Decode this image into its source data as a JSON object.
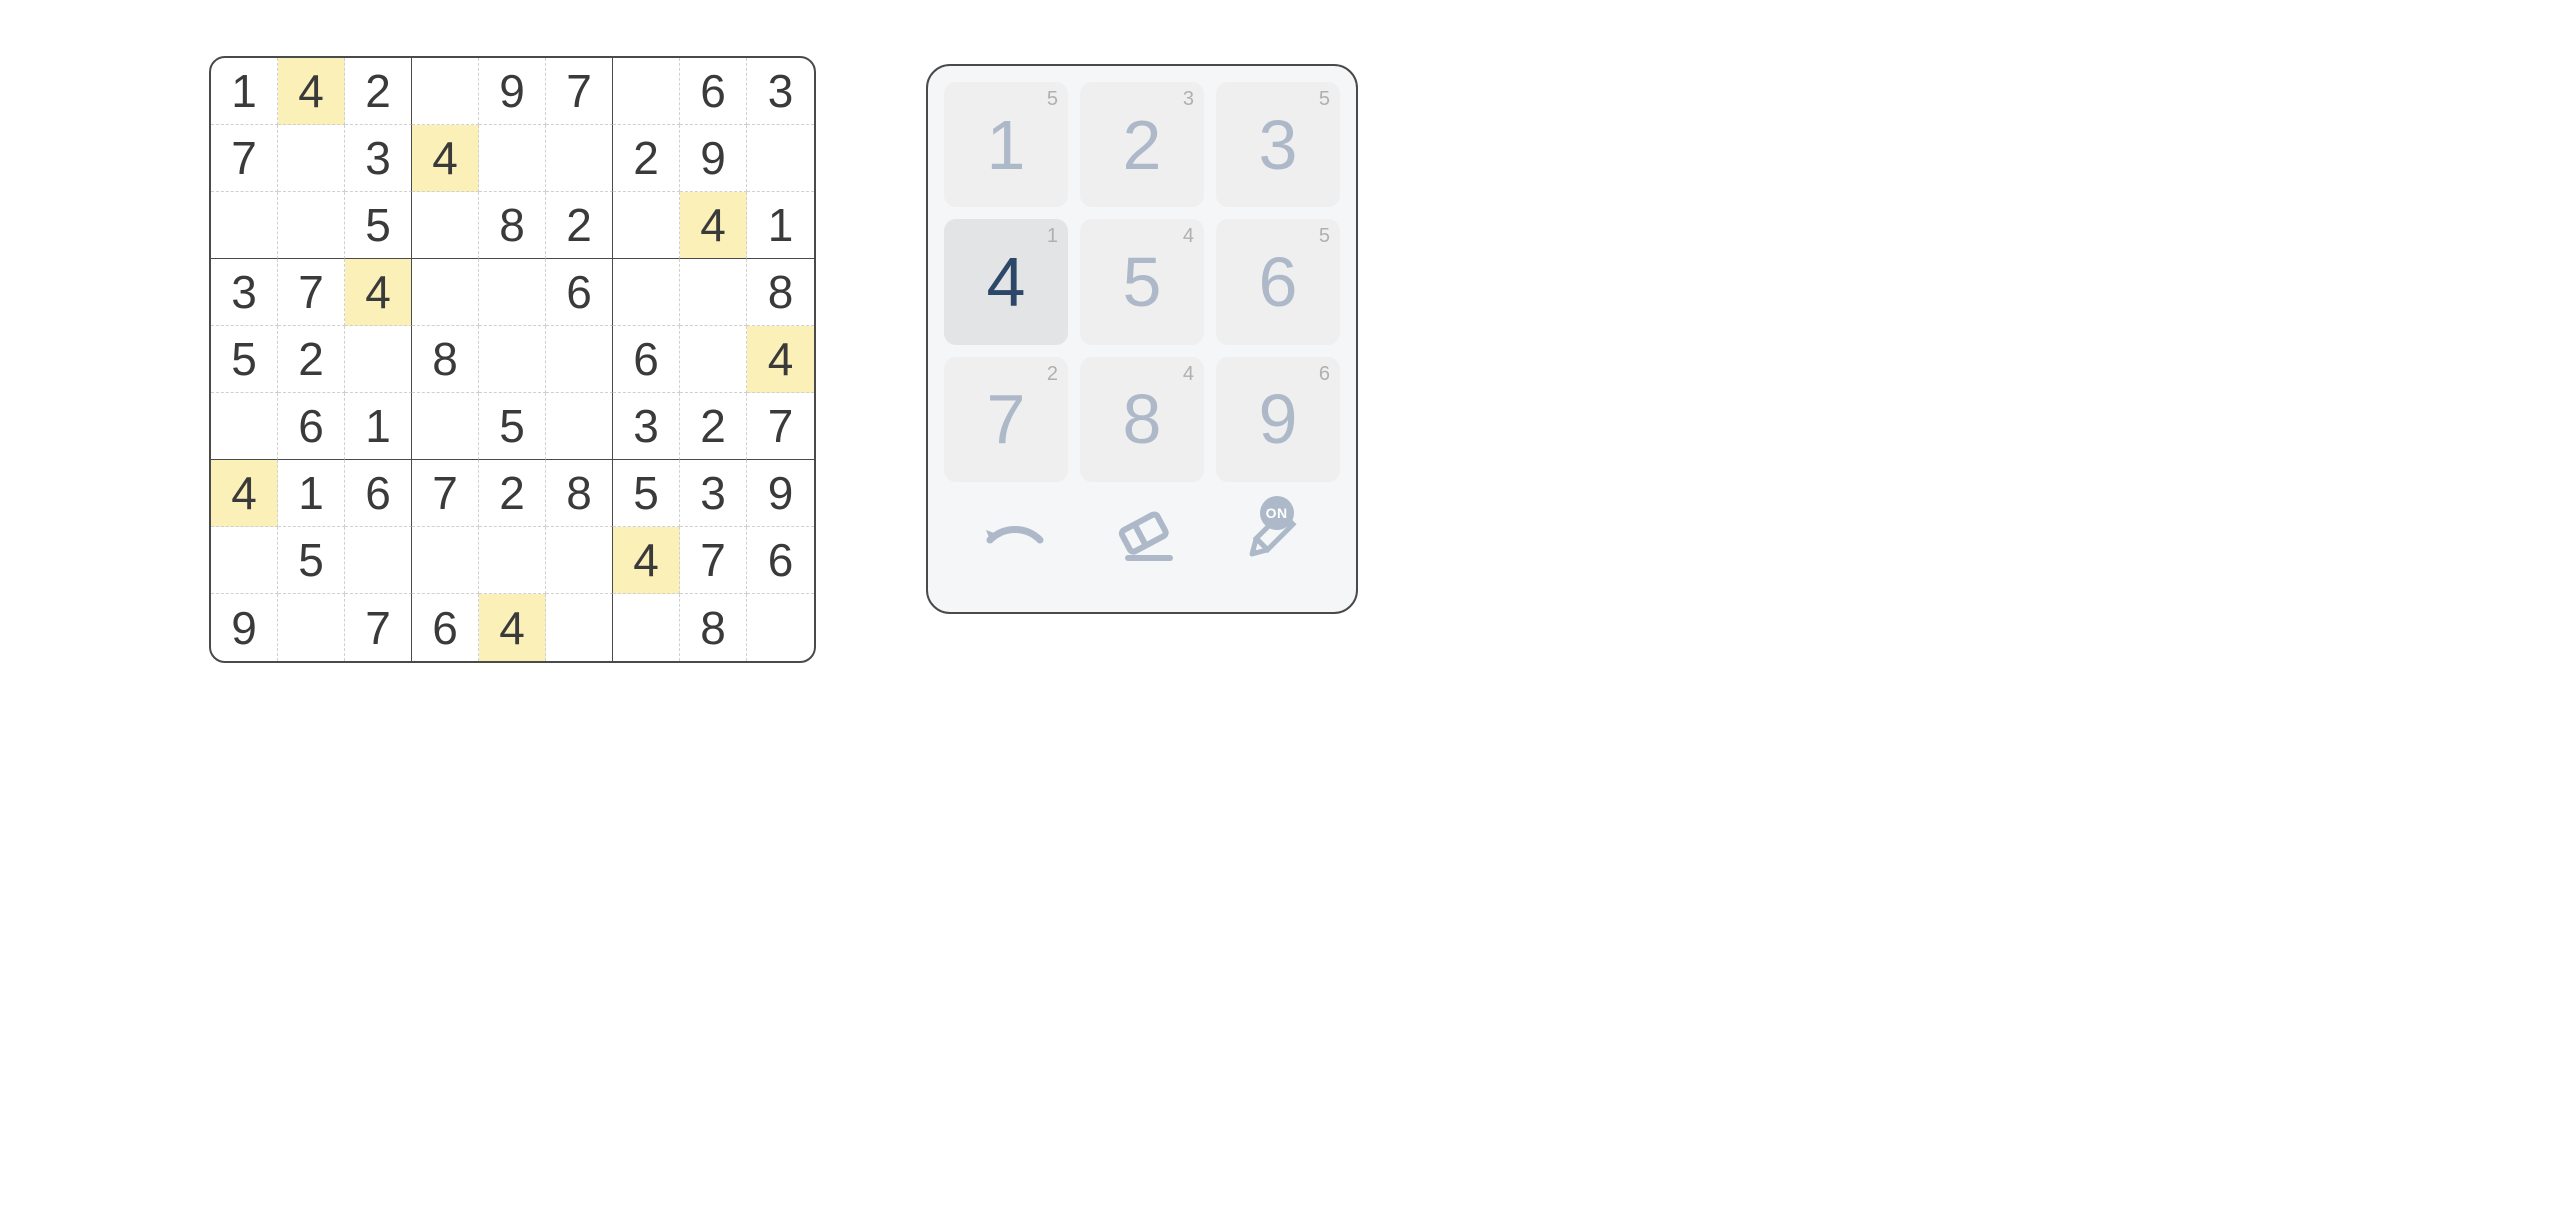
{
  "sudoku": {
    "highlight_value": 4,
    "rows": [
      [
        {
          "v": 1
        },
        {
          "v": 4,
          "hl": true
        },
        {
          "v": 2
        },
        {
          "v": null
        },
        {
          "v": 9
        },
        {
          "v": 7
        },
        {
          "v": null
        },
        {
          "v": 6
        },
        {
          "v": 3
        }
      ],
      [
        {
          "v": 7
        },
        {
          "v": null
        },
        {
          "v": 3
        },
        {
          "v": 4,
          "hl": true
        },
        {
          "v": null
        },
        {
          "v": null
        },
        {
          "v": 2
        },
        {
          "v": 9
        },
        {
          "v": null
        }
      ],
      [
        {
          "v": null
        },
        {
          "v": null
        },
        {
          "v": 5
        },
        {
          "v": null
        },
        {
          "v": 8
        },
        {
          "v": 2
        },
        {
          "v": null
        },
        {
          "v": 4,
          "hl": true
        },
        {
          "v": 1
        }
      ],
      [
        {
          "v": 3
        },
        {
          "v": 7
        },
        {
          "v": 4,
          "hl": true
        },
        {
          "v": null
        },
        {
          "v": null
        },
        {
          "v": 6
        },
        {
          "v": null
        },
        {
          "v": null
        },
        {
          "v": 8
        }
      ],
      [
        {
          "v": 5
        },
        {
          "v": 2
        },
        {
          "v": null
        },
        {
          "v": 8
        },
        {
          "v": null
        },
        {
          "v": null
        },
        {
          "v": 6
        },
        {
          "v": null
        },
        {
          "v": 4,
          "hl": true
        }
      ],
      [
        {
          "v": null
        },
        {
          "v": 6
        },
        {
          "v": 1
        },
        {
          "v": null
        },
        {
          "v": 5
        },
        {
          "v": null
        },
        {
          "v": 3
        },
        {
          "v": 2
        },
        {
          "v": 7
        }
      ],
      [
        {
          "v": 4,
          "hl": true
        },
        {
          "v": 1
        },
        {
          "v": 6
        },
        {
          "v": 7
        },
        {
          "v": 2
        },
        {
          "v": 8
        },
        {
          "v": 5
        },
        {
          "v": 3
        },
        {
          "v": 9
        }
      ],
      [
        {
          "v": null
        },
        {
          "v": 5
        },
        {
          "v": null
        },
        {
          "v": null
        },
        {
          "v": null
        },
        {
          "v": null
        },
        {
          "v": 4,
          "hl": true
        },
        {
          "v": 7
        },
        {
          "v": 6
        }
      ],
      [
        {
          "v": 9
        },
        {
          "v": null
        },
        {
          "v": 7
        },
        {
          "v": 6
        },
        {
          "v": 4,
          "hl": true
        },
        {
          "v": null
        },
        {
          "v": null
        },
        {
          "v": 8
        },
        {
          "v": null
        }
      ]
    ]
  },
  "pad": {
    "buttons": [
      {
        "n": 1,
        "remaining": 5,
        "active": false
      },
      {
        "n": 2,
        "remaining": 3,
        "active": false
      },
      {
        "n": 3,
        "remaining": 5,
        "active": false
      },
      {
        "n": 4,
        "remaining": 1,
        "active": true
      },
      {
        "n": 5,
        "remaining": 4,
        "active": false
      },
      {
        "n": 6,
        "remaining": 5,
        "active": false
      },
      {
        "n": 7,
        "remaining": 2,
        "active": false
      },
      {
        "n": 8,
        "remaining": 4,
        "active": false
      },
      {
        "n": 9,
        "remaining": 6,
        "active": false
      }
    ],
    "notes_badge": "ON"
  }
}
